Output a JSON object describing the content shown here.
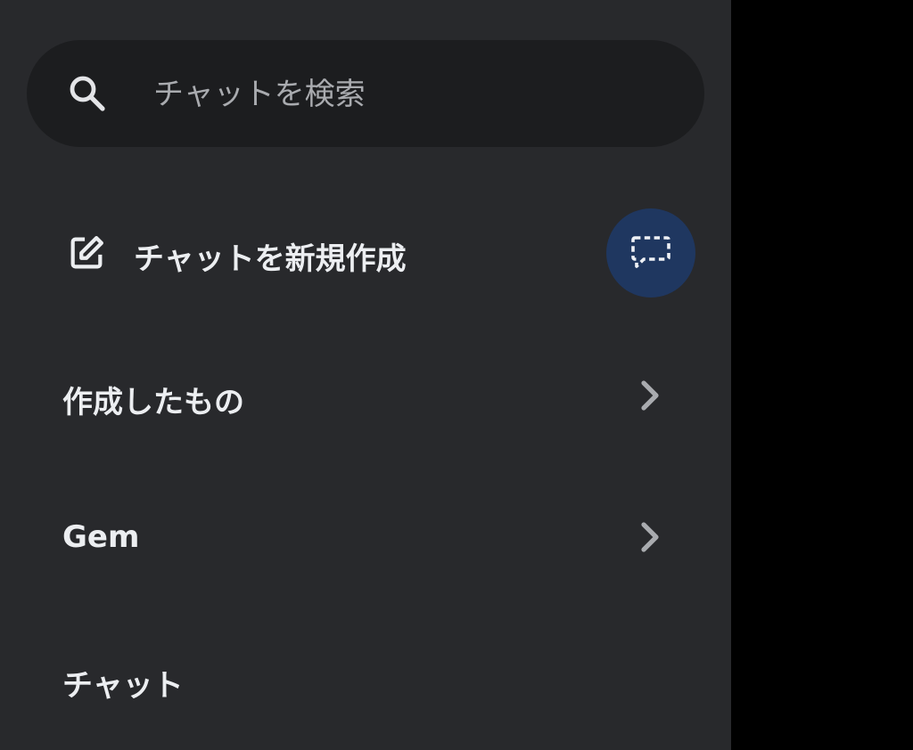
{
  "search": {
    "placeholder": "チャットを検索",
    "value": ""
  },
  "new_chat": {
    "label": "チャットを新規作成"
  },
  "temporary_chat": {
    "icon": "temporary-chat-icon",
    "color": "#1f3760"
  },
  "nav": {
    "items": [
      {
        "label": "作成したもの",
        "icon": "chevron-right-icon"
      },
      {
        "label": "Gem",
        "icon": "chevron-right-icon"
      }
    ]
  },
  "chats": {
    "heading": "チャット"
  },
  "colors": {
    "drawer_background": "#28292c",
    "search_background": "#1c1d1f",
    "text_primary": "#eceef1",
    "text_secondary": "#a9abaf",
    "accent": "#1f3760",
    "scrim": "#000000"
  }
}
